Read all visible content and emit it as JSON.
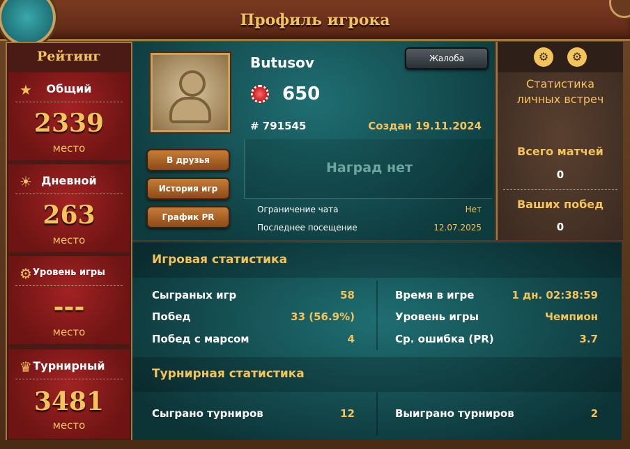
{
  "header": {
    "title": "Профиль игрока"
  },
  "rating": {
    "title": "Рейтинг",
    "general": {
      "label": "Общий",
      "value": "2339",
      "place": "место"
    },
    "daily": {
      "label": "Дневной",
      "value": "263",
      "place": "место"
    },
    "level": {
      "label": "Уровень игры",
      "value": "---",
      "place": "место"
    },
    "tournament": {
      "label": "Турнирный",
      "value": "3481",
      "place": "место"
    }
  },
  "profile": {
    "username": "Butusov",
    "rating": "650",
    "id": "# 791545",
    "created": "Создан 19.11.2024",
    "complain_label": "Жалоба",
    "buttons": [
      "В друзья",
      "История игр",
      "График PR"
    ],
    "awards": "Наград нет",
    "chat_limit_label": "Ограничение чата",
    "chat_limit_value": "Нет",
    "last_visit_label": "Последнее посещение",
    "last_visit_value": "12.07.2025"
  },
  "h2h": {
    "title": "Статистика личных встреч",
    "total_label": "Всего матчей",
    "total_value": "0",
    "wins_label": "Ваших побед",
    "wins_value": "0"
  },
  "game_stats": {
    "title": "Игровая статистика",
    "left": [
      {
        "label": "Сыграных игр",
        "value": "58"
      },
      {
        "label": "Побед",
        "value": "33 (56.9%)"
      },
      {
        "label": "Побед с марсом",
        "value": "4"
      }
    ],
    "right": [
      {
        "label": "Время в игре",
        "value": "1 дн. 02:38:59"
      },
      {
        "label": "Уровень игры",
        "value": "Чемпион"
      },
      {
        "label": "Ср. ошибка (PR)",
        "value": "3.7"
      }
    ]
  },
  "tournament_stats": {
    "title": "Турнирная статистика",
    "played_label": "Сыграно турниров",
    "played_value": "12",
    "won_label": "Выиграно турниров",
    "won_value": "2"
  },
  "colors": {
    "accent": "#f4c35a",
    "teal": "#1f6e72",
    "red": "#a22222"
  },
  "icons": [
    "avatar-icon",
    "star-icon",
    "sun-icon",
    "brain-icon",
    "trophy-icon",
    "chip-icon",
    "close-icon"
  ]
}
